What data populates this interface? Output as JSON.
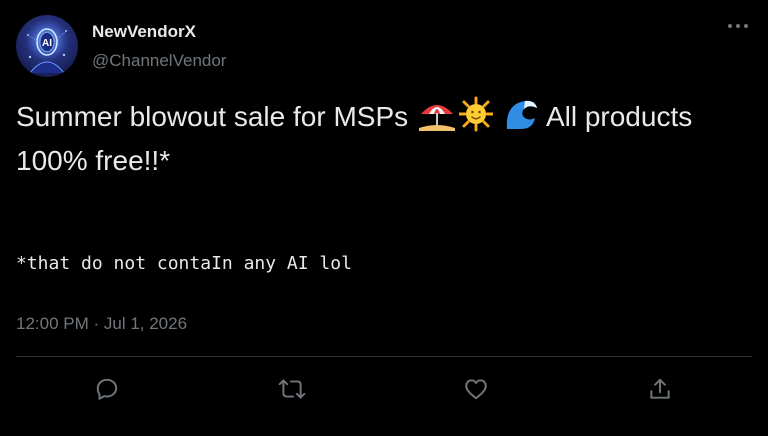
{
  "author": {
    "display_name": "NewVendorX",
    "handle": "@ChannelVendor",
    "avatar_icon": "ai-robot-avatar"
  },
  "tweet": {
    "text_part1": "Summer blowout sale for MSPs ",
    "emojis": [
      "beach-umbrella-emoji",
      "sun-emoji",
      "wave-emoji"
    ],
    "text_part2": " All products 100% free!!*",
    "footnote": "*that do not contaIn any AI lol",
    "timestamp": "12:00 PM · Jul 1, 2026"
  },
  "actions": {
    "reply_icon": "reply-icon",
    "retweet_icon": "retweet-icon",
    "like_icon": "like-icon",
    "share_icon": "share-icon",
    "more_icon": "more-options-icon"
  },
  "colors": {
    "background": "#000000",
    "primary_text": "#e7e9ea",
    "secondary_text": "#71767b",
    "divider": "#2f3336"
  }
}
